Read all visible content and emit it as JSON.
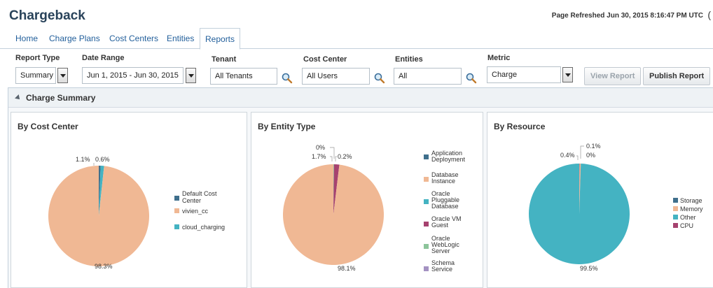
{
  "header": {
    "title": "Chargeback",
    "refresh_text": "Page Refreshed Jun 30, 2015 8:16:47 PM UTC",
    "refresh_trail": "("
  },
  "tabs": [
    {
      "label": "Home"
    },
    {
      "label": "Charge Plans"
    },
    {
      "label": "Cost Centers"
    },
    {
      "label": "Entities"
    },
    {
      "label": "Reports",
      "active": true
    }
  ],
  "filters": {
    "report_type": {
      "label": "Report Type",
      "value": "Summary"
    },
    "date_range": {
      "label": "Date Range",
      "value": "Jun 1, 2015 - Jun 30, 2015"
    },
    "tenant": {
      "label": "Tenant",
      "value": "All Tenants"
    },
    "cost_center": {
      "label": "Cost Center",
      "value": "All Users"
    },
    "entities": {
      "label": "Entities",
      "value": "All"
    },
    "metric": {
      "label": "Metric",
      "value": "Charge"
    },
    "view_report": "View Report",
    "publish_report": "Publish Report"
  },
  "section": {
    "title": "Charge Summary"
  },
  "colors": {
    "peach": "#f0b894",
    "teal": "#44b3c2",
    "steel": "#3f6f8c",
    "crimson": "#a6426f",
    "green": "#8cc49a",
    "lavender": "#a492c2",
    "accent_blue": "#225f9b"
  },
  "icons": {
    "search": "magnifier-icon",
    "dropdown": "chevron-down-icon",
    "disclose": "disclosure-triangle-icon"
  },
  "chart_data": [
    {
      "type": "pie",
      "title": "By Cost Center",
      "slices": [
        {
          "label": "Default Cost Center",
          "value": 0.6,
          "color": "#3f6f8c"
        },
        {
          "label": "vivien_cc",
          "value": 98.3,
          "color": "#f0b894"
        },
        {
          "label": "cloud_charging",
          "value": 1.1,
          "color": "#44b3c2"
        }
      ],
      "annotations": [
        "1.1%",
        "0.6%",
        "98.3%"
      ],
      "legend": "right"
    },
    {
      "type": "pie",
      "title": "By Entity Type",
      "slices": [
        {
          "label": "Application Deployment",
          "value": 0.0,
          "color": "#3f6f8c"
        },
        {
          "label": "Database Instance",
          "value": 98.1,
          "color": "#f0b894"
        },
        {
          "label": "Oracle Pluggable Database",
          "value": 0.0,
          "color": "#44b3c2"
        },
        {
          "label": "Oracle VM Guest",
          "value": 1.7,
          "color": "#a6426f"
        },
        {
          "label": "Oracle WebLogic Server",
          "value": 0.2,
          "color": "#8cc49a"
        },
        {
          "label": "Schema Service",
          "value": 0.0,
          "color": "#a492c2"
        }
      ],
      "annotations": [
        "0%",
        "1.7%",
        "0.2%",
        "98.1%"
      ],
      "legend": "right"
    },
    {
      "type": "pie",
      "title": "By Resource",
      "slices": [
        {
          "label": "Storage",
          "value": 0.0,
          "color": "#3f6f8c"
        },
        {
          "label": "Memory",
          "value": 0.4,
          "color": "#f0b894"
        },
        {
          "label": "Other",
          "value": 99.5,
          "color": "#44b3c2"
        },
        {
          "label": "CPU",
          "value": 0.1,
          "color": "#a6426f"
        }
      ],
      "annotations": [
        "0.1%",
        "0.4%",
        "0%",
        "99.5%"
      ],
      "legend": "right"
    }
  ]
}
